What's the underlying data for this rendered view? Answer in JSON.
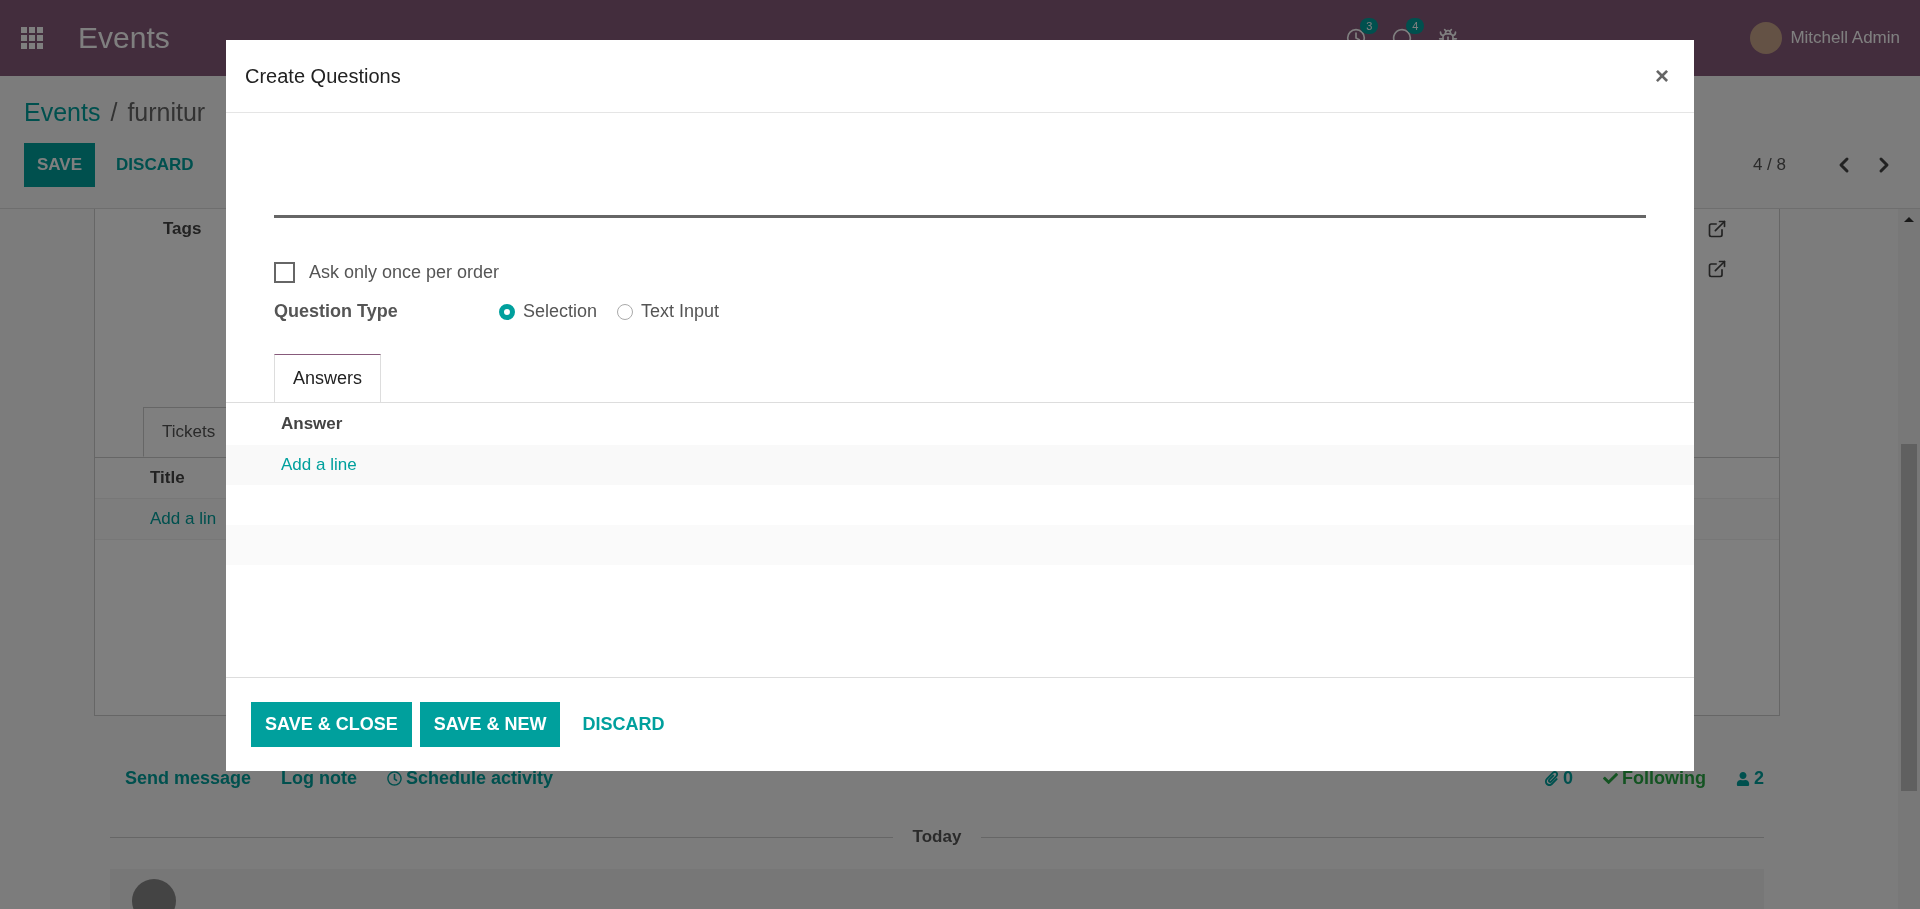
{
  "navbar": {
    "app_name": "Events",
    "activity_count": "3",
    "message_count": "4",
    "user": "Mitchell Admin"
  },
  "breadcrumb": [
    "Events",
    "/",
    "furnitur"
  ],
  "actions": [
    {
      "label": "SAVE",
      "kind": "primary"
    },
    {
      "label": "DISCARD",
      "kind": "link"
    }
  ],
  "pager": "4 / 8",
  "form": {
    "tags_label": "Tags",
    "tabs": [
      {
        "label": "Tickets",
        "selected": true
      }
    ],
    "columns": [
      "Title"
    ],
    "add_line": "Add a lin"
  },
  "chatter": {
    "actions": [
      "Send message",
      "Log note",
      "Schedule activity"
    ],
    "attachments": "0",
    "follow": "Following",
    "followers": "2",
    "divider": "Today"
  },
  "dialog": {
    "title": "Create Questions",
    "close": "×",
    "once": {
      "label": "Ask only once per order",
      "checked": false
    },
    "question_type": {
      "label": "Question Type",
      "options": [
        {
          "label": "Selection",
          "selected": true
        },
        {
          "label": "Text Input",
          "selected": false
        }
      ]
    },
    "tabs": [
      {
        "label": "Answers",
        "selected": true
      }
    ],
    "columns": [
      "Answer"
    ],
    "add_line": "Add a line",
    "buttons": [
      {
        "label": "SAVE & CLOSE",
        "kind": "primary"
      },
      {
        "label": "SAVE & NEW",
        "kind": "primary"
      },
      {
        "label": "DISCARD",
        "kind": "link"
      }
    ]
  }
}
